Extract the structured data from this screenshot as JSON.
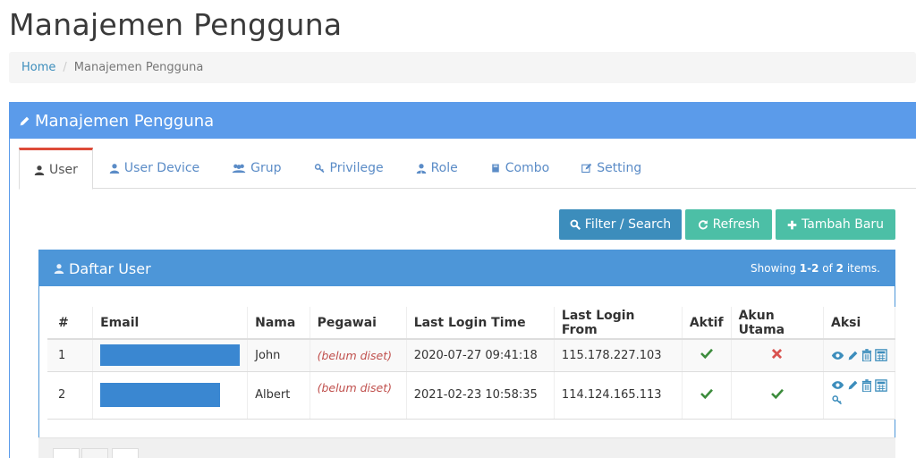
{
  "page": {
    "title": "Manajemen Pengguna"
  },
  "breadcrumb": {
    "home": "Home",
    "separator": "/",
    "current": "Manajemen Pengguna"
  },
  "panel": {
    "title": "Manajemen Pengguna",
    "icon": "pencil-icon"
  },
  "tabs": [
    {
      "label": "User",
      "icon": "user-icon",
      "active": true
    },
    {
      "label": "User Device",
      "icon": "user-icon"
    },
    {
      "label": "Grup",
      "icon": "users-icon"
    },
    {
      "label": "Privilege",
      "icon": "key-icon"
    },
    {
      "label": "Role",
      "icon": "user-tie-icon"
    },
    {
      "label": "Combo",
      "icon": "book-icon"
    },
    {
      "label": "Setting",
      "icon": "edit-icon"
    }
  ],
  "toolbar": {
    "filter_label": "Filter / Search",
    "refresh_label": "Refresh",
    "add_label": "Tambah Baru"
  },
  "list": {
    "title": "Daftar User",
    "summary_prefix": "Showing ",
    "summary_range": "1-2",
    "summary_of": " of ",
    "summary_total": "2",
    "summary_suffix": " items."
  },
  "table": {
    "headers": [
      "#",
      "Email",
      "Nama",
      "Pegawai",
      "Last Login Time",
      "Last Login From",
      "Aktif",
      "Akun Utama",
      "Aksi"
    ],
    "rows": [
      {
        "num": "1",
        "nama": "John",
        "pegawai": "(belum diset)",
        "last_login_time": "2020-07-27 09:41:18",
        "last_login_from": "115.178.227.103",
        "aktif": "check",
        "akun_utama": "cross"
      },
      {
        "num": "2",
        "nama": "Albert",
        "pegawai": "(belum diset)",
        "last_login_time": "2021-02-23 10:58:35",
        "last_login_from": "114.124.165.113",
        "aktif": "check",
        "akun_utama": "check"
      }
    ]
  },
  "colors": {
    "accent": "#5b9bea",
    "inner": "#4d96d8",
    "filter_btn": "#3c8dbc",
    "green_btn": "#4cbfa6",
    "active_tab": "#dd4b39",
    "check": "#3c8c3c",
    "cross": "#d9534f"
  }
}
